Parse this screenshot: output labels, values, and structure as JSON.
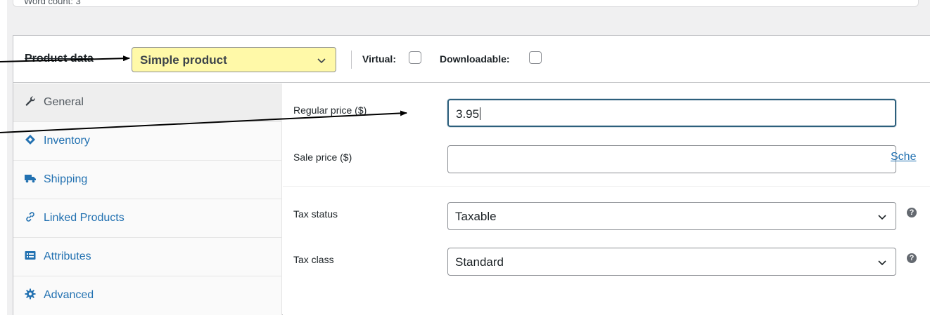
{
  "word_count": {
    "text": "Word count: 3"
  },
  "product_data": {
    "title": "Product data",
    "type_select": {
      "value": "Simple product"
    },
    "virtual_label": "Virtual:",
    "downloadable_label": "Downloadable:"
  },
  "tabs": [
    {
      "label": "General",
      "icon": "wrench-icon",
      "active": true
    },
    {
      "label": "Inventory",
      "icon": "tag-icon",
      "active": false
    },
    {
      "label": "Shipping",
      "icon": "truck-icon",
      "active": false
    },
    {
      "label": "Linked Products",
      "icon": "link-icon",
      "active": false
    },
    {
      "label": "Attributes",
      "icon": "list-icon",
      "active": false
    },
    {
      "label": "Advanced",
      "icon": "gear-icon",
      "active": false
    }
  ],
  "fields": {
    "regular_price": {
      "label": "Regular price ($)",
      "value": "3.95"
    },
    "sale_price": {
      "label": "Sale price ($)",
      "value": "",
      "schedule_link": "Sche"
    },
    "tax_status": {
      "label": "Tax status",
      "value": "Taxable",
      "help": "?"
    },
    "tax_class": {
      "label": "Tax class",
      "value": "Standard",
      "help": "?"
    }
  },
  "colors": {
    "link": "#2271b1",
    "highlight": "#fff9a8",
    "focus_border": "#2c5f7c"
  }
}
